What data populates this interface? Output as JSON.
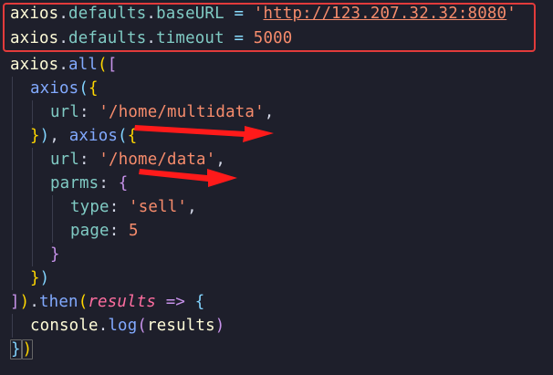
{
  "code": {
    "l1": {
      "a": "axios",
      "b": ".",
      "c": "defaults",
      "d": ".",
      "e": "baseURL",
      "f": " = ",
      "g": "'",
      "h": "http://123.207.32.32:8080",
      "i": "'"
    },
    "l2": {
      "a": "axios",
      "b": ".",
      "c": "defaults",
      "d": ".",
      "e": "timeout",
      "f": " = ",
      "g": "5000"
    },
    "l3": {
      "a": "axios",
      "b": ".",
      "c": "all",
      "d": "(",
      "e": "["
    },
    "l4": {
      "a": "axios",
      "b": "(",
      "c": "{"
    },
    "l5": {
      "a": "url",
      "b": ": ",
      "c": "'/home/multidata'",
      "d": ","
    },
    "l6": {
      "a": "}",
      "b": ")",
      "c": ", ",
      "d": "axios",
      "e": "(",
      "f": "{"
    },
    "l7": {
      "a": "url",
      "b": ": ",
      "c": "'/home/data'",
      "d": ","
    },
    "l8": {
      "a": "parms",
      "b": ": ",
      "c": "{"
    },
    "l9": {
      "a": "type",
      "b": ": ",
      "c": "'sell'",
      "d": ","
    },
    "l10": {
      "a": "page",
      "b": ": ",
      "c": "5"
    },
    "l11": {
      "a": "}"
    },
    "l12": {
      "a": "}",
      "b": ")"
    },
    "l13": {
      "a": "]",
      "b": ")",
      "c": ".",
      "d": "then",
      "e": "(",
      "f": "results",
      "g": " => ",
      "h": "{"
    },
    "l14": {
      "a": "console",
      "b": ".",
      "c": "log",
      "d": "(",
      "e": "results",
      "f": ")"
    },
    "l15": {
      "a": "}",
      "b": ")"
    }
  },
  "colors": {
    "background": "#1e1f2b",
    "highlight_box": "#e23b3b",
    "annotation_arrow": "#ff1a1a"
  }
}
